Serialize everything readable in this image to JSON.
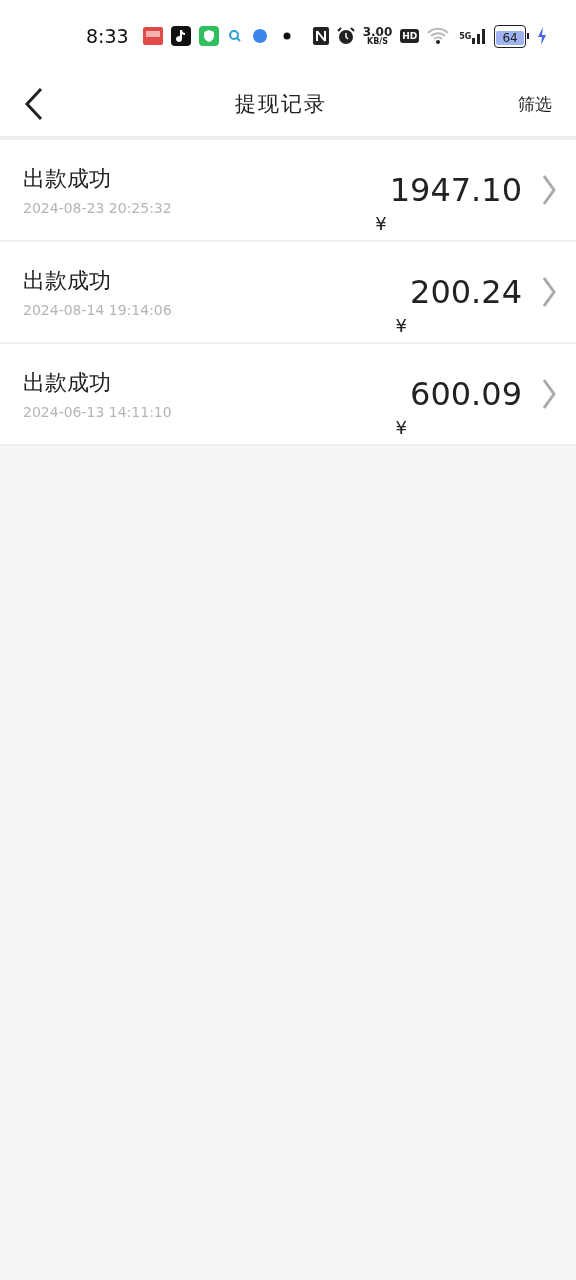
{
  "status_bar": {
    "time": "8:33",
    "speed_value": "3.00",
    "speed_unit": "KB/S",
    "hd": "HD",
    "network": "5G",
    "battery": "64"
  },
  "header": {
    "title": "提现记录",
    "filter": "筛选"
  },
  "records": [
    {
      "status": "出款成功",
      "time": "2024-08-23 20:25:32",
      "currency": "¥",
      "amount": "1947.10"
    },
    {
      "status": "出款成功",
      "time": "2024-08-14 19:14:06",
      "currency": "¥",
      "amount": "200.24"
    },
    {
      "status": "出款成功",
      "time": "2024-06-13 14:11:10",
      "currency": "¥",
      "amount": "600.09"
    }
  ]
}
